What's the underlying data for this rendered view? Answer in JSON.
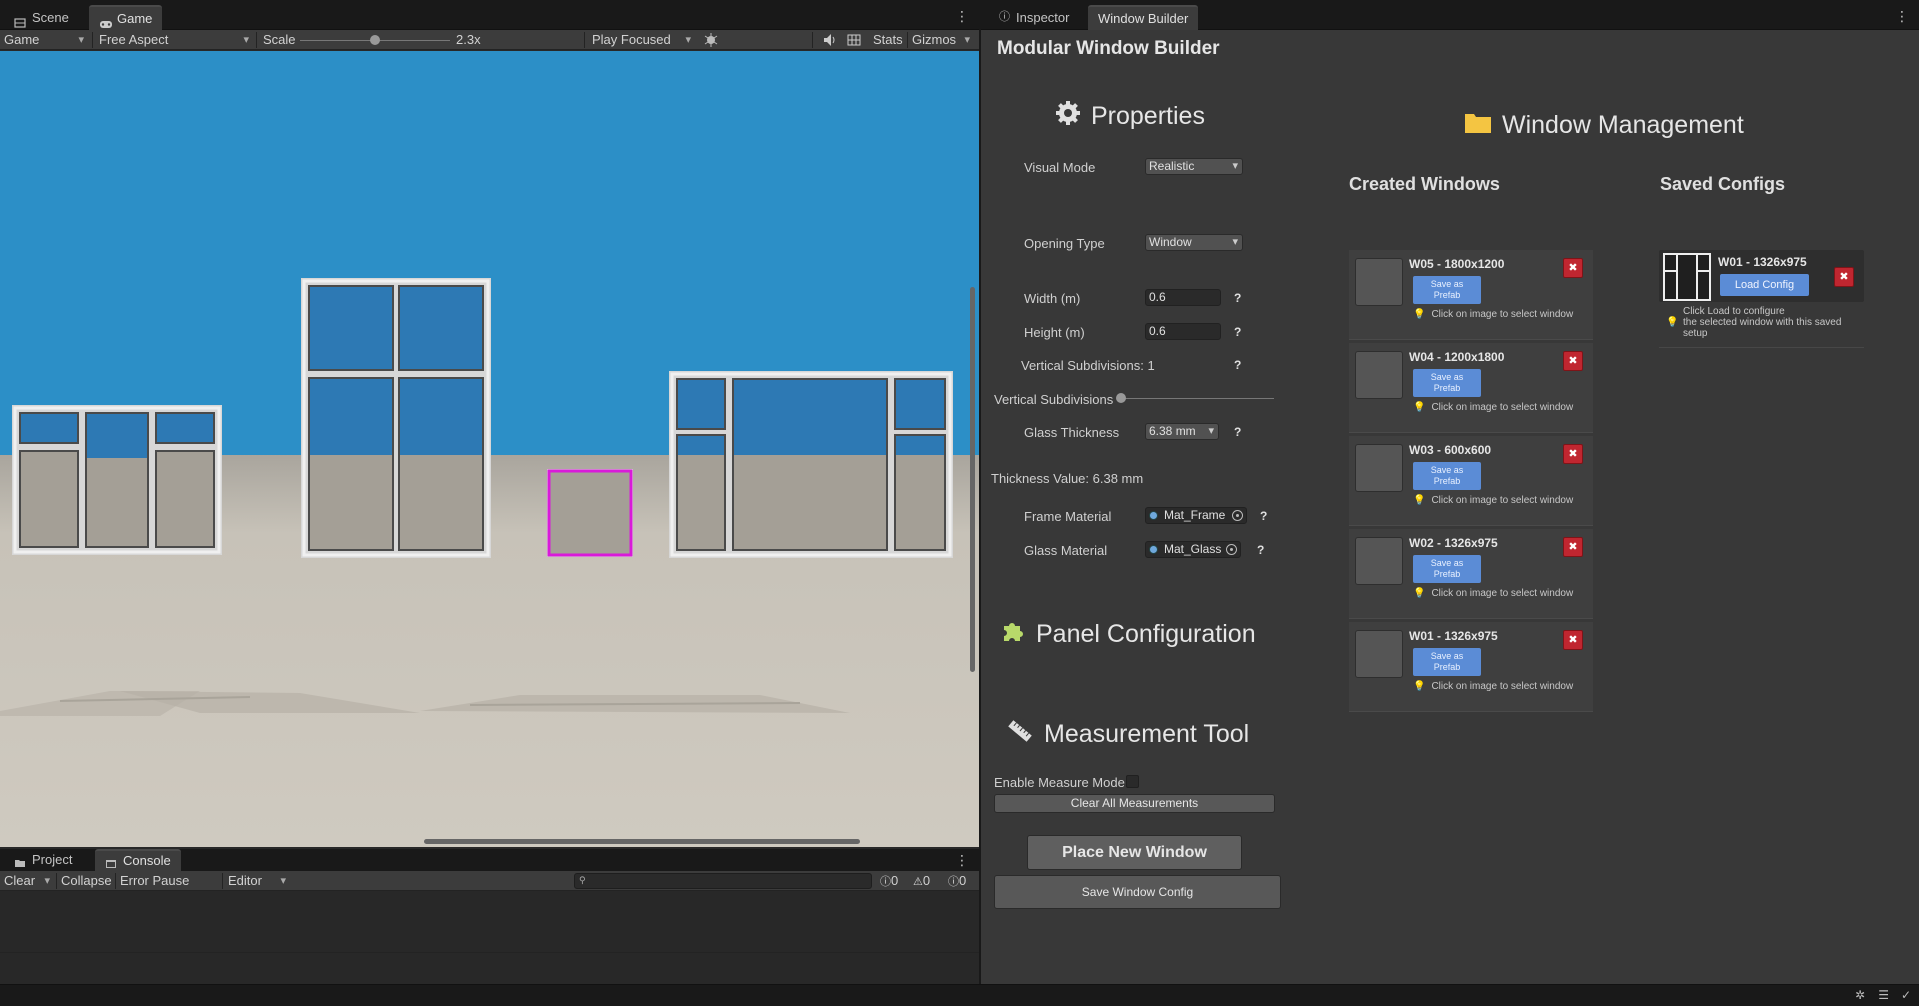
{
  "left_tabs": {
    "scene": "Scene",
    "game": "Game"
  },
  "game_toolbar": {
    "display": "Game",
    "aspect": "Free Aspect",
    "scale_label": "Scale",
    "scale_value": "2.3x",
    "scale_fraction": 0.5,
    "play_mode": "Play Focused",
    "stats": "Stats",
    "gizmos": "Gizmos"
  },
  "console_tabs": {
    "project": "Project",
    "console": "Console"
  },
  "console_toolbar": {
    "clear": "Clear",
    "collapse": "Collapse",
    "error_pause": "Error Pause",
    "editor": "Editor",
    "info_count": "0",
    "warn_count": "0",
    "error_count": "0"
  },
  "right_tabs": {
    "inspector": "Inspector",
    "window_builder": "Window Builder"
  },
  "builder": {
    "title": "Modular Window Builder",
    "properties_title": "Properties",
    "visual_mode_label": "Visual Mode",
    "visual_mode_value": "Realistic",
    "opening_type_label": "Opening Type",
    "opening_type_value": "Window",
    "width_label": "Width (m)",
    "width_value": "0.6",
    "height_label": "Height (m)",
    "height_value": "0.6",
    "vsub_text": "Vertical Subdivisions: 1",
    "vsub_slider_label": "Vertical Subdivisions",
    "vsub_fraction": 0.0,
    "glass_thickness_label": "Glass Thickness",
    "glass_thickness_value": "6.38 mm",
    "thickness_value_text": "Thickness Value: 6.38 mm",
    "frame_material_label": "Frame Material",
    "frame_material_value": "Mat_Frame",
    "glass_material_label": "Glass Material",
    "glass_material_value": "Mat_Glass",
    "help": "?",
    "panel_config_title": "Panel Configuration",
    "measurement_title": "Measurement Tool",
    "enable_measure_label": "Enable Measure Mode",
    "clear_measure_label": "Clear All Measurements",
    "place_window_label": "Place New Window",
    "save_config_label": "Save Window Config"
  },
  "management": {
    "title": "Window Management",
    "created_title": "Created Windows",
    "saved_title": "Saved Configs",
    "save_prefab_label": "Save as\nPrefab",
    "hint": "Click on image to select window",
    "delete_glyph": "✖",
    "windows": [
      {
        "name": "W05 - 1800x1200"
      },
      {
        "name": "W04 - 1200x1800"
      },
      {
        "name": "W03 - 600x600"
      },
      {
        "name": "W02 - 1326x975"
      },
      {
        "name": "W01 - 1326x975"
      }
    ],
    "saved_configs": [
      {
        "name": "W01 - 1326x975",
        "load_label": "Load Config",
        "hint_lines": [
          "Click Load to configure",
          "the selected window with this saved",
          "setup"
        ]
      }
    ]
  },
  "colors": {
    "sky": "#2c8fc7",
    "ground": "#cfcac0",
    "accent_blue": "#5b8cd6",
    "delete_red": "#c02630",
    "selection": "#d91ad9"
  }
}
